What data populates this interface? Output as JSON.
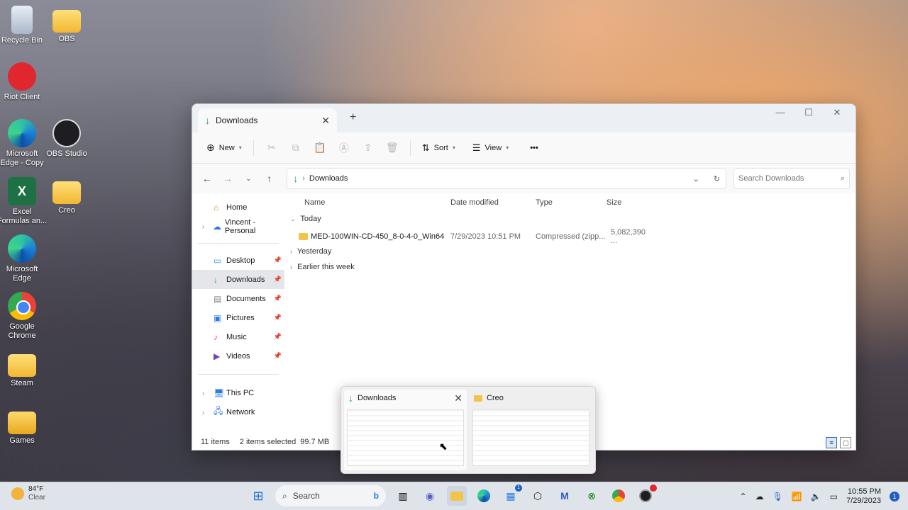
{
  "desktop": {
    "icons": [
      {
        "label": "Recycle Bin"
      },
      {
        "label": "OBS"
      },
      {
        "label": "Riot Client"
      },
      {
        "label": "Microsoft Edge - Copy"
      },
      {
        "label": "OBS Studio"
      },
      {
        "label": "Excel Formulas an..."
      },
      {
        "label": "Creo"
      },
      {
        "label": "Microsoft Edge"
      },
      {
        "label": "Google Chrome"
      },
      {
        "label": "Steam"
      },
      {
        "label": "Games"
      }
    ]
  },
  "window": {
    "tab_title": "Downloads",
    "toolbar": {
      "new_label": "New",
      "sort_label": "Sort",
      "view_label": "View",
      "more_label": "•••"
    },
    "address": {
      "path": "Downloads",
      "search_placeholder": "Search Downloads"
    },
    "sidebar": {
      "items": [
        {
          "label": "Home"
        },
        {
          "label": "Vincent - Personal"
        },
        {
          "label": "Desktop"
        },
        {
          "label": "Downloads"
        },
        {
          "label": "Documents"
        },
        {
          "label": "Pictures"
        },
        {
          "label": "Music"
        },
        {
          "label": "Videos"
        },
        {
          "label": "This PC"
        },
        {
          "label": "Network"
        }
      ]
    },
    "columns": {
      "name": "Name",
      "date": "Date modified",
      "type": "Type",
      "size": "Size"
    },
    "groups": {
      "today": "Today",
      "yesterday": "Yesterday",
      "earlier": "Earlier this week"
    },
    "files": [
      {
        "name": "MED-100WIN-CD-450_8-0-4-0_Win64",
        "date": "7/29/2023 10:51 PM",
        "type": "Compressed (zipp...",
        "size": "5,082,390 ..."
      }
    ],
    "status": {
      "items": "11 items",
      "selected": "2 items selected",
      "size": "99.7 MB"
    }
  },
  "thumbnails": {
    "first": "Downloads",
    "second": "Creo"
  },
  "taskbar": {
    "weather_temp": "84°F",
    "weather_desc": "Clear",
    "search_label": "Search",
    "time": "10:55 PM",
    "date": "7/29/2023",
    "notif_count": "1",
    "store_badge": "1"
  }
}
